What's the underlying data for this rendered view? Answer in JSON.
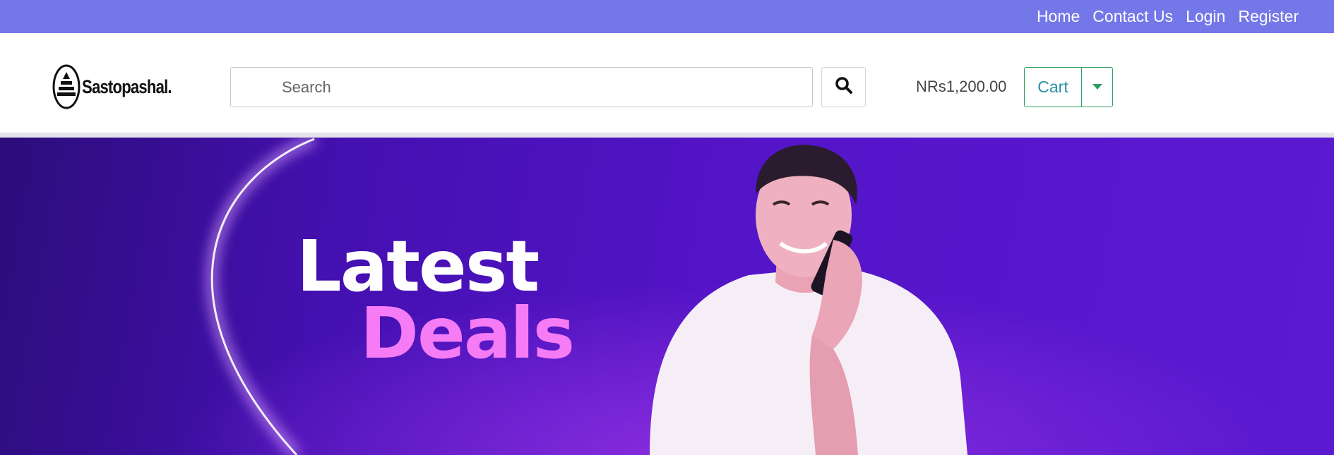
{
  "topnav": {
    "items": [
      {
        "label": "Home"
      },
      {
        "label": "Contact Us"
      },
      {
        "label": "Login"
      },
      {
        "label": "Register"
      }
    ]
  },
  "header": {
    "logo_text": "Sastopashal.",
    "search": {
      "placeholder": "Search",
      "value": ""
    },
    "search_icon": "search-icon",
    "price": "NRs1,200.00",
    "cart_label": "Cart",
    "cart_dropdown_icon": "caret-down-icon"
  },
  "hero": {
    "line1": "Latest",
    "line2": "Deals"
  },
  "colors": {
    "topbar": "#7477e8",
    "cart_border": "#2e9e62",
    "hero_accent": "#f57cf5",
    "hero_bg": "#4a12be"
  }
}
